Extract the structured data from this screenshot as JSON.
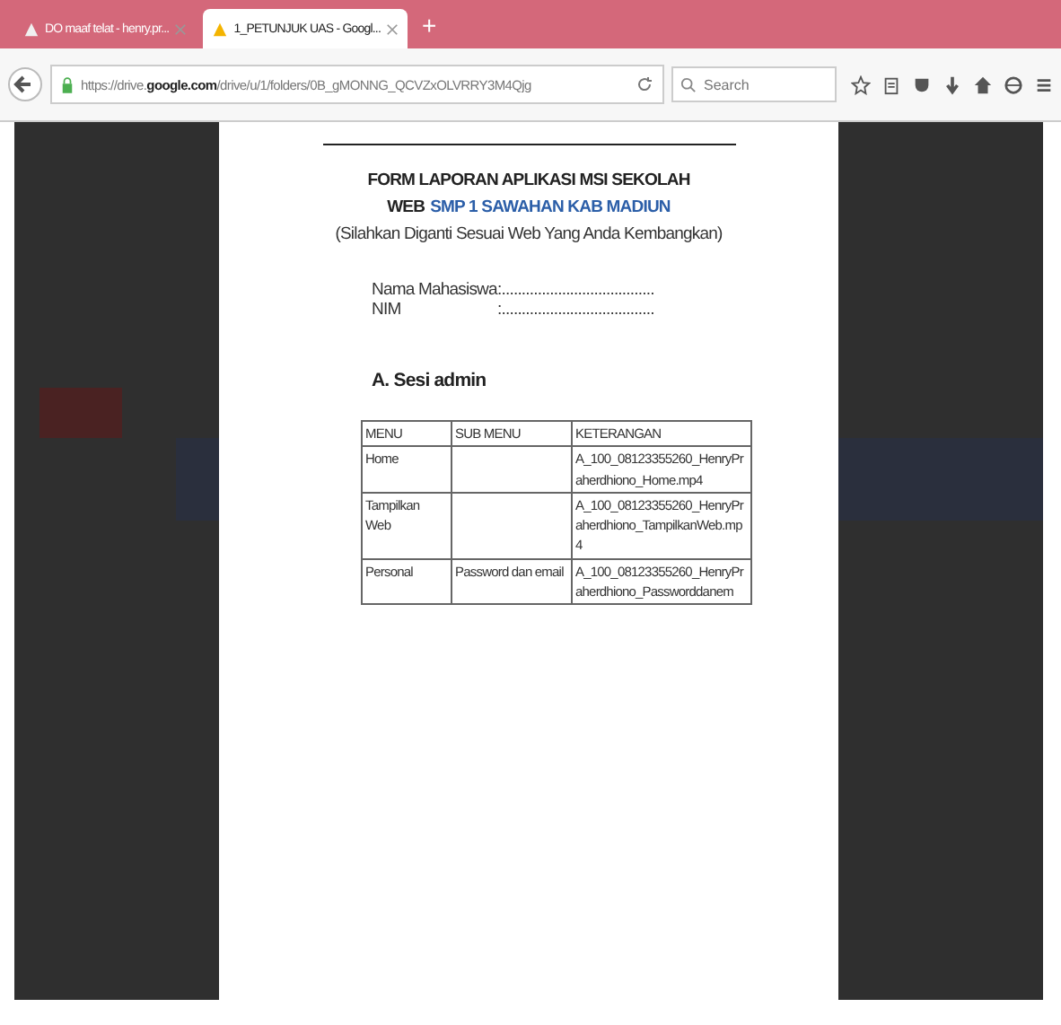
{
  "browser": {
    "tabs": [
      {
        "title": "DO maaf telat - henry.pr...",
        "selected": false
      },
      {
        "title": "1_PETUNJUK UAS - Googl...",
        "selected": true
      }
    ],
    "new_tab": "+",
    "address": "https://drive.**google.com**/drive/u/1/folders/0B_gMONNG_QCVZxOLVRRY3M4Qjg",
    "search": {
      "placeholder": "Search"
    }
  },
  "document": {
    "title": "FORM LAPORAN APLIKASI MSI SEKOLAH",
    "subtitle_prefix": "WEB",
    "subtitle_highlight": "SMP 1 SAWAHAN KAB MADIUN",
    "note": "(Silahkan Diganti Sesuai Web Yang Anda Kembangkan)",
    "fields": [
      {
        "label": "Nama Mahasiswa",
        "value": ":......................................"
      },
      {
        "label": "NIM",
        "value": ":......................................"
      }
    ],
    "section": "A. Sesi admin",
    "table": {
      "columns": [
        "MENU",
        "SUB MENU",
        "KETERANGAN"
      ],
      "rows": [
        [
          "Home",
          "",
          "A_100_08123355260_HenryPraherdhiono_Home.mp4"
        ],
        [
          "Tampilkan Web",
          "",
          "A_100_08123355260_HenryPraherdhiono_TampilkanWeb.mp4"
        ],
        [
          "Personal",
          "Password dan email",
          "A_100_08123355260_HenryPraherdhiono_Passworddanem"
        ]
      ]
    }
  }
}
